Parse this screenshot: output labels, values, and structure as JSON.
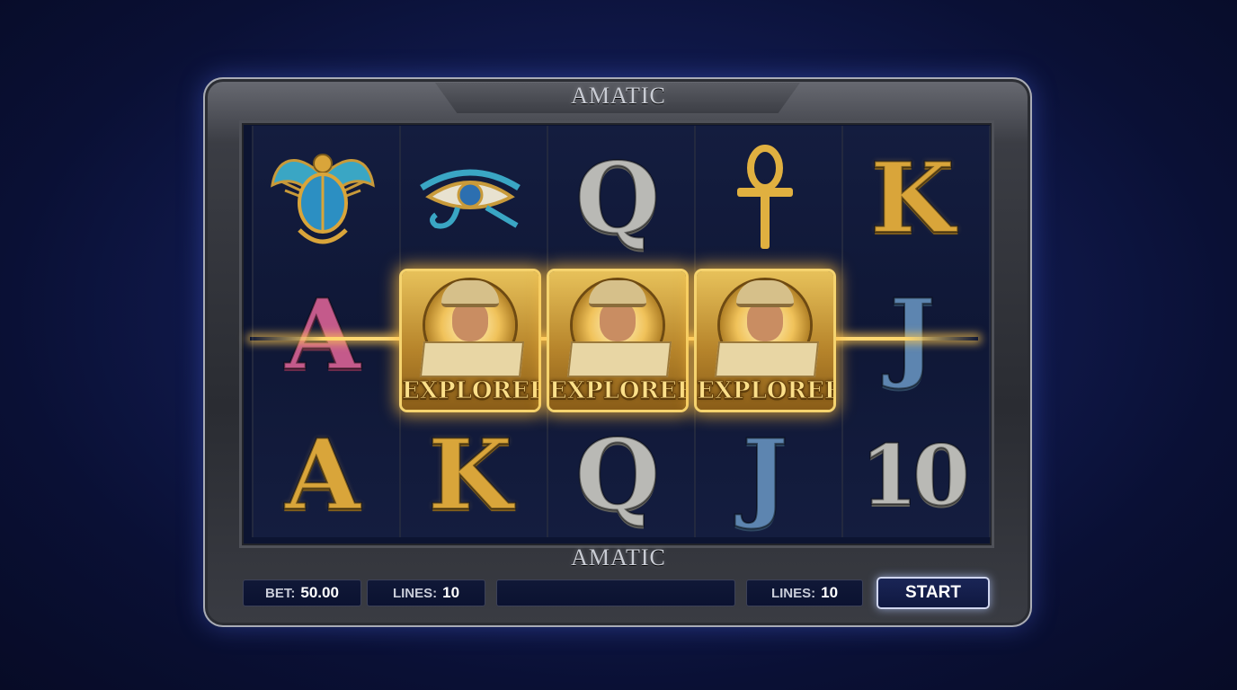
{
  "header": {
    "brand_top": "AMATIC"
  },
  "footer": {
    "brand_bottom": "AMATIC"
  },
  "reels": [
    [
      {
        "symbol": "scarab-icon"
      },
      {
        "symbol": "A",
        "style": "pink"
      },
      {
        "symbol": "A",
        "style": "gold-ornate"
      }
    ],
    [
      {
        "symbol": "eye-of-horus-icon"
      },
      {
        "symbol": "EXPLORER",
        "winning": true
      },
      {
        "symbol": "K",
        "style": "gold"
      }
    ],
    [
      {
        "symbol": "Q",
        "style": "stone"
      },
      {
        "symbol": "EXPLORER",
        "winning": true
      },
      {
        "symbol": "Q",
        "style": "stone"
      }
    ],
    [
      {
        "symbol": "ankh-icon"
      },
      {
        "symbol": "EXPLORER",
        "winning": true
      },
      {
        "symbol": "J",
        "style": "blue"
      }
    ],
    [
      {
        "symbol": "K",
        "style": "gold"
      },
      {
        "symbol": "J",
        "style": "blue"
      },
      {
        "symbol": "10",
        "style": "stone"
      }
    ]
  ],
  "symbols_text": {
    "A": "A",
    "K": "K",
    "Q": "Q",
    "J": "J",
    "ten": "10",
    "explorer": "EXPLORER"
  },
  "controls": {
    "bet_label": "BET:",
    "bet_value": "50.00",
    "lines_label_left": "LINES:",
    "lines_value_left": "10",
    "message": "",
    "lines_label_right": "LINES:",
    "lines_value_right": "10",
    "start_label": "START"
  },
  "colors": {
    "background": "#0a1035",
    "win_glow": "#ffd66b",
    "gold": "#d9a53a",
    "stone": "#b9b9b5",
    "pink": "#c45a8b",
    "blue": "#5d85b0"
  }
}
